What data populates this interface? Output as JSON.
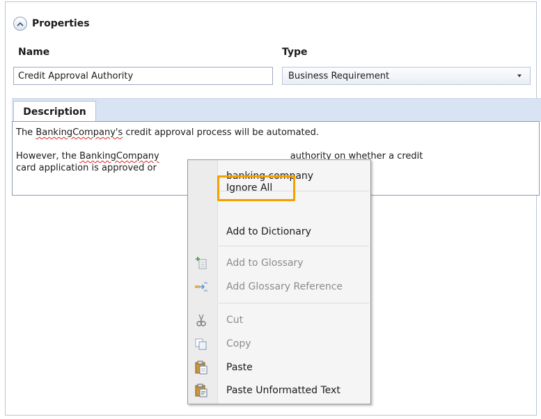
{
  "properties": {
    "title": "Properties"
  },
  "fields": {
    "name_label": "Name",
    "name_value": "Credit Approval Authority",
    "type_label": "Type",
    "type_value": "Business Requirement"
  },
  "tabs": [
    {
      "label": "Description"
    }
  ],
  "editor": {
    "line1": {
      "word": "BankingCompany's",
      "rest": " credit approval process will be automated."
    },
    "line2": {
      "lead": "However, the ",
      "word": "BankingCompany",
      "rest": "authority on whether a credit"
    },
    "line3": {
      "text": "card application is approved or"
    }
  },
  "context_menu": {
    "suggestion": "banking company",
    "ignore_all": "Ignore All",
    "add_to_dictionary": "Add to Dictionary",
    "add_to_glossary": "Add to Glossary",
    "add_glossary_reference": "Add Glossary Reference",
    "cut": "Cut",
    "copy": "Copy",
    "paste": "Paste",
    "paste_unformatted": "Paste Unformatted Text"
  },
  "colors": {
    "highlight": "#f2a100",
    "tab_bar": "#d8e4f3",
    "spell_underline": "#e02020"
  },
  "icons": [
    "chevron-up-icon",
    "dropdown-caret-icon",
    "add-to-glossary-icon",
    "glossary-reference-icon",
    "scissors-icon",
    "copy-icon",
    "paste-icon",
    "paste-unformatted-icon"
  ]
}
